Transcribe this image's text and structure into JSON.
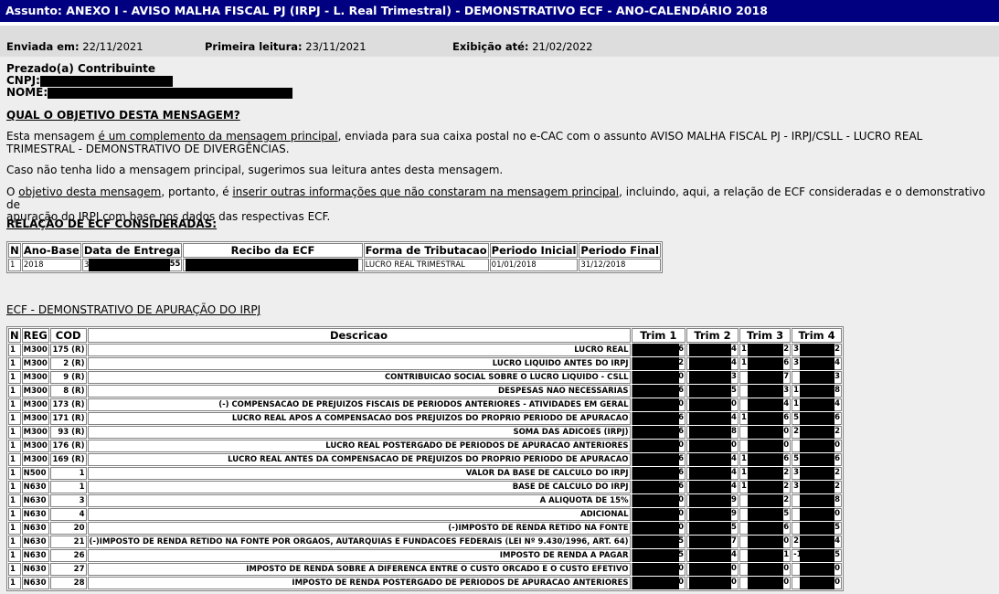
{
  "subject": "Assunto: ANEXO I - AVISO MALHA FISCAL PJ (IRPJ - L. Real Trimestral) - DEMONSTRATIVO ECF - ANO-CALENDÁRIO 2018",
  "meta": {
    "sent_label": "Enviada em:",
    "sent_value": "22/11/2021",
    "first_read_label": "Primeira leitura:",
    "first_read_value": "23/11/2021",
    "display_until_label": "Exibição até:",
    "display_until_value": "21/02/2022"
  },
  "greeting": {
    "salutation": "Prezado(a) Contribuinte",
    "cnpj_label": "CNPJ:",
    "nome_label": "NOME:"
  },
  "objective": {
    "heading": "QUAL O OBJETIVO DESTA MENSAGEM?",
    "p1_a": "Esta mensagem ",
    "p1_link": "é um complemento da mensagem principal",
    "p1_b": ", enviada para sua caixa postal no e-CAC com o assunto AVISO MALHA FISCAL PJ - IRPJ/CSLL - LUCRO REAL",
    "p1_c": "TRIMESTRAL - DEMONSTRATIVO DE DIVERGÊNCIAS.",
    "p2": "Caso não tenha lido a mensagem principal, sugerimos sua leitura antes desta mensagem.",
    "p3_a": "O ",
    "p3_u1": "objetivo desta mensagem",
    "p3_b": ", portanto, é ",
    "p3_u2": "inserir outras informações que não constaram na mensagem principal",
    "p3_c": ", incluindo, aqui, a relação de ECF consideradas e o demonstrativo de",
    "p3_d": "apuração do IRPJ com base nos dados das respectivas ECF."
  },
  "ecf_list": {
    "heading": "RELAÇÃO DE ECF CONSIDERADAS:",
    "columns": [
      "N",
      "Ano-Base",
      "Data de Entrega",
      "Recibo da ECF",
      "Forma de Tributacao",
      "Periodo Inicial",
      "Periodo Final"
    ],
    "row": {
      "n": "1",
      "ano": "2018",
      "entrega_start": "3",
      "entrega_end": "55",
      "forma": "LUCRO REAL TRIMESTRAL",
      "inicio": "01/01/2018",
      "fim": "31/12/2018"
    }
  },
  "irpj": {
    "heading": "ECF - DEMONSTRATIVO DE APURAÇÃO DO IRPJ",
    "columns": [
      "N",
      "REG",
      "COD",
      "Descricao",
      "Trim 1",
      "Trim 2",
      "Trim 3",
      "Trim 4"
    ],
    "rows": [
      {
        "n": "1",
        "reg": "M300",
        "cod": "175 (R)",
        "desc": "LUCRO REAL",
        "t1": "6",
        "t2": "4",
        "t3a": "1",
        "t3b": "2",
        "t4a": "3",
        "t4b": "2"
      },
      {
        "n": "1",
        "reg": "M300",
        "cod": "2 (R)",
        "desc": "LUCRO LIQUIDO ANTES DO IRPJ",
        "t1": "2",
        "t2": "4",
        "t3a": "1",
        "t3b": "6",
        "t4a": "3",
        "t4b": "4"
      },
      {
        "n": "1",
        "reg": "M300",
        "cod": "9 (R)",
        "desc": "CONTRIBUICAO SOCIAL SOBRE O LUCRO LIQUIDO - CSLL",
        "t1": "0",
        "t2": "3",
        "t3a": "",
        "t3b": "7",
        "t4a": "",
        "t4b": "3"
      },
      {
        "n": "1",
        "reg": "M300",
        "cod": "8 (R)",
        "desc": "DESPESAS NAO NECESSARIAS",
        "t1": "6",
        "t2": "5",
        "t3a": "",
        "t3b": "3",
        "t4a": "1",
        "t4b": "8"
      },
      {
        "n": "1",
        "reg": "M300",
        "cod": "173 (R)",
        "desc": "(-) COMPENSACAO DE PREJUIZOS FISCAIS DE PERIODOS ANTERIORES - ATIVIDADES EM GERAL",
        "t1": "0",
        "t2": "0",
        "t3a": "",
        "t3b": "4",
        "t4a": "1",
        "t4b": "4"
      },
      {
        "n": "1",
        "reg": "M300",
        "cod": "171 (R)",
        "desc": "LUCRO REAL APOS A COMPENSACAO DOS PREJUIZOS DO PROPRIO PERIODO DE APURACAO",
        "t1": "6",
        "t2": "4",
        "t3a": "1",
        "t3b": "6",
        "t4a": "5",
        "t4b": "6"
      },
      {
        "n": "1",
        "reg": "M300",
        "cod": "93 (R)",
        "desc": "SOMA DAS ADICOES (IRPJ)",
        "t1": "6",
        "t2": "8",
        "t3a": "",
        "t3b": "0",
        "t4a": "2",
        "t4b": "2"
      },
      {
        "n": "1",
        "reg": "M300",
        "cod": "176 (R)",
        "desc": "LUCRO REAL POSTERGADO DE PERIODOS DE APURACAO ANTERIORES",
        "t1": "0",
        "t2": "0",
        "t3a": "",
        "t3b": "0",
        "t4a": "",
        "t4b": "0"
      },
      {
        "n": "1",
        "reg": "M300",
        "cod": "169 (R)",
        "desc": "LUCRO REAL ANTES DA COMPENSACAO DE PREJUIZOS DO PROPRIO PERIODO DE APURACAO",
        "t1": "6",
        "t2": "4",
        "t3a": "1",
        "t3b": "6",
        "t4a": "5",
        "t4b": "6"
      },
      {
        "n": "1",
        "reg": "N500",
        "cod": "1",
        "desc": "VALOR DA BASE DE CALCULO DO IRPJ",
        "t1": "6",
        "t2": "4",
        "t3a": "1",
        "t3b": "2",
        "t4a": "3",
        "t4b": "2"
      },
      {
        "n": "1",
        "reg": "N630",
        "cod": "1",
        "desc": "BASE DE CALCULO DO IRPJ",
        "t1": "6",
        "t2": "4",
        "t3a": "1",
        "t3b": "2",
        "t4a": "3",
        "t4b": "2"
      },
      {
        "n": "1",
        "reg": "N630",
        "cod": "3",
        "desc": "A ALIQUOTA DE 15%",
        "t1": "0",
        "t2": "9",
        "t3a": "",
        "t3b": "2",
        "t4a": "",
        "t4b": "8"
      },
      {
        "n": "1",
        "reg": "N630",
        "cod": "4",
        "desc": "ADICIONAL",
        "t1": "0",
        "t2": "9",
        "t3a": "",
        "t3b": "5",
        "t4a": "",
        "t4b": "0"
      },
      {
        "n": "1",
        "reg": "N630",
        "cod": "20",
        "desc": "(-)IMPOSTO DE RENDA RETIDO NA FONTE",
        "t1": "0",
        "t2": "5",
        "t3a": "",
        "t3b": "6",
        "t4a": "",
        "t4b": "5"
      },
      {
        "n": "1",
        "reg": "N630",
        "cod": "21",
        "desc": "(-)IMPOSTO DE RENDA RETIDO NA FONTE POR ORGAOS, AUTARQUIAS E FUNDACOES FEDERAIS (LEI Nº 9.430/1996, ART. 64)",
        "t1": "5",
        "t2": "7",
        "t3a": "",
        "t3b": "0",
        "t4a": "2",
        "t4b": "4"
      },
      {
        "n": "1",
        "reg": "N630",
        "cod": "26",
        "desc": "IMPOSTO DE RENDA A PAGAR",
        "t1": "5",
        "t2": "4",
        "t3a": "",
        "t3b": "1",
        "t4a": "-1",
        "t4b": "5"
      },
      {
        "n": "1",
        "reg": "N630",
        "cod": "27",
        "desc": "IMPOSTO DE RENDA SOBRE A DIFERENCA ENTRE O CUSTO ORCADO E O CUSTO EFETIVO",
        "t1": "0",
        "t2": "0",
        "t3a": "",
        "t3b": "0",
        "t4a": "",
        "t4b": "0"
      },
      {
        "n": "1",
        "reg": "N630",
        "cod": "28",
        "desc": "IMPOSTO DE RENDA POSTERGADO DE PERIODOS DE APURACAO ANTERIORES",
        "t1": "0",
        "t2": "0",
        "t3a": "",
        "t3b": "0",
        "t4a": "",
        "t4b": "0"
      }
    ]
  }
}
